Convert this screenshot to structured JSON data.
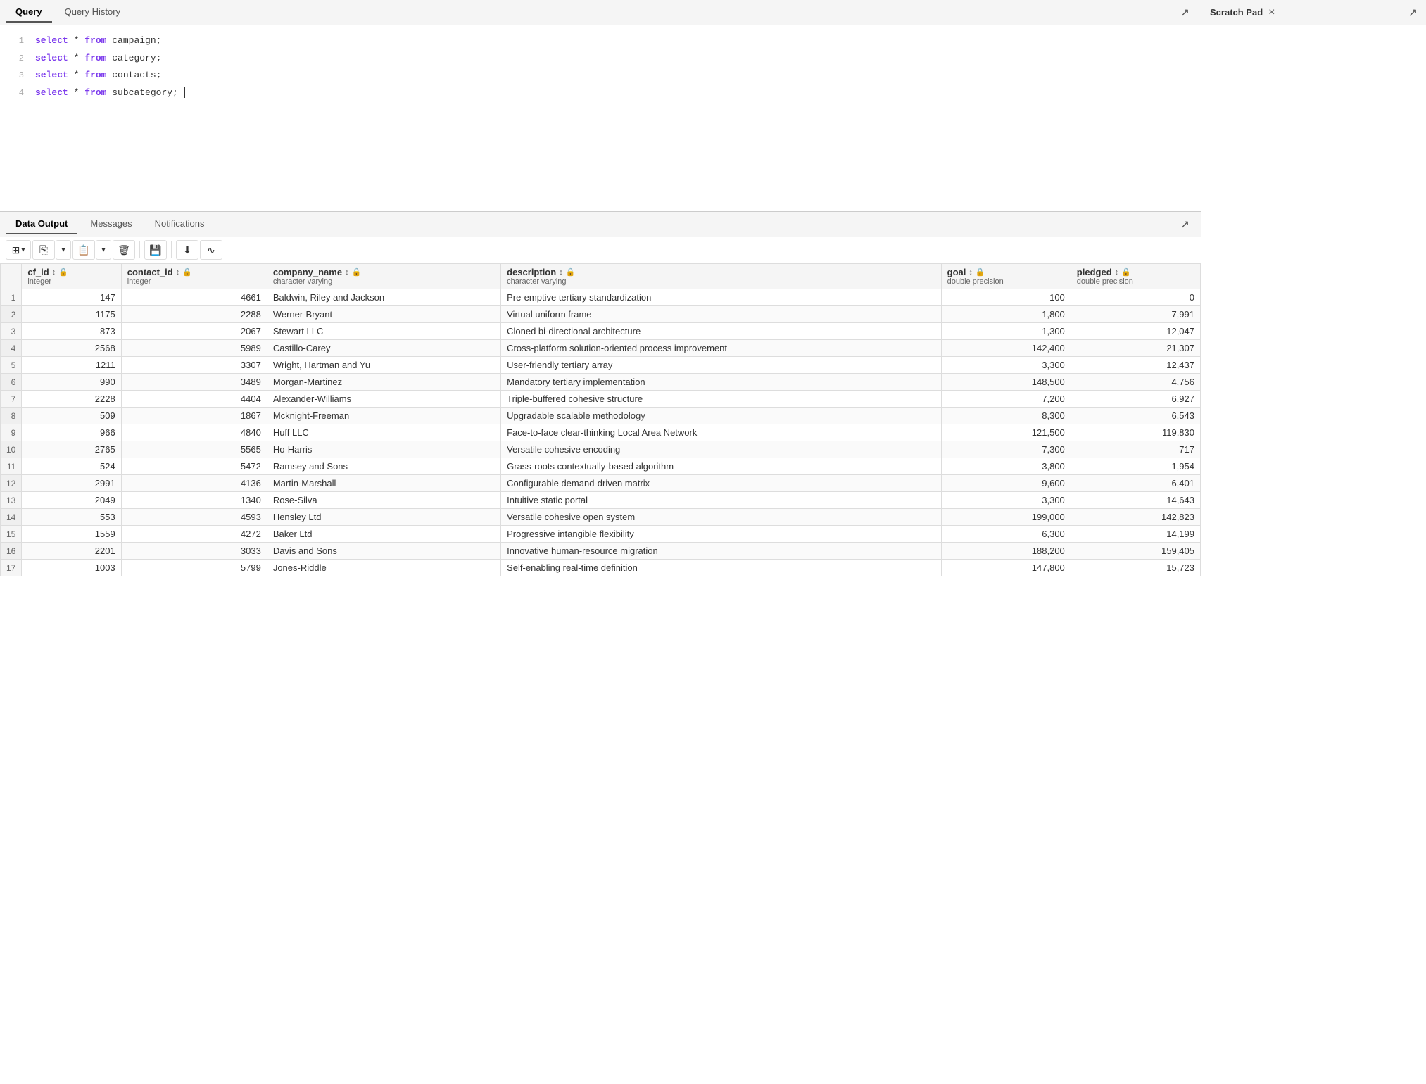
{
  "topTabs": {
    "query": "Query",
    "queryHistory": "Query History"
  },
  "queryEditor": {
    "expandIcon": "↗",
    "lines": [
      {
        "num": 1,
        "code": "select * from campaign;"
      },
      {
        "num": 2,
        "code": "select * from category;"
      },
      {
        "num": 3,
        "code": "select * from contacts;"
      },
      {
        "num": 4,
        "code": "select * from subcategory;"
      }
    ]
  },
  "scratchPad": {
    "title": "Scratch Pad",
    "closeIcon": "×",
    "expandIcon": "↗"
  },
  "outputTabs": {
    "dataOutput": "Data Output",
    "messages": "Messages",
    "notifications": "Notifications",
    "expandIcon": "↗"
  },
  "toolbar": {
    "addCol": "⊞",
    "copy": "⧉",
    "chevronDown": "∨",
    "paste": "⊡",
    "chevronDown2": "∨",
    "delete": "⊠",
    "save": "⛁",
    "download": "⬇",
    "graph": "∿"
  },
  "table": {
    "columns": [
      {
        "name": "cf_id",
        "type": "integer",
        "lock": true
      },
      {
        "name": "contact_id",
        "type": "integer",
        "lock": true
      },
      {
        "name": "company_name",
        "type": "character varying",
        "lock": true
      },
      {
        "name": "description",
        "type": "character varying",
        "lock": true
      },
      {
        "name": "goal",
        "type": "double precision",
        "lock": true
      },
      {
        "name": "pledged",
        "type": "double precision",
        "lock": true
      }
    ],
    "rows": [
      {
        "n": 1,
        "cf_id": 147,
        "contact_id": 4661,
        "company_name": "Baldwin, Riley and Jackson",
        "description": "Pre-emptive tertiary standardization",
        "goal": 100,
        "pledged": 0
      },
      {
        "n": 2,
        "cf_id": 1175,
        "contact_id": 2288,
        "company_name": "Werner-Bryant",
        "description": "Virtual uniform frame",
        "goal": 1800,
        "pledged": 7991
      },
      {
        "n": 3,
        "cf_id": 873,
        "contact_id": 2067,
        "company_name": "Stewart LLC",
        "description": "Cloned bi-directional architecture",
        "goal": 1300,
        "pledged": 12047
      },
      {
        "n": 4,
        "cf_id": 2568,
        "contact_id": 5989,
        "company_name": "Castillo-Carey",
        "description": "Cross-platform solution-oriented process improvement",
        "goal": 142400,
        "pledged": 21307
      },
      {
        "n": 5,
        "cf_id": 1211,
        "contact_id": 3307,
        "company_name": "Wright, Hartman and Yu",
        "description": "User-friendly tertiary array",
        "goal": 3300,
        "pledged": 12437
      },
      {
        "n": 6,
        "cf_id": 990,
        "contact_id": 3489,
        "company_name": "Morgan-Martinez",
        "description": "Mandatory tertiary implementation",
        "goal": 148500,
        "pledged": 4756
      },
      {
        "n": 7,
        "cf_id": 2228,
        "contact_id": 4404,
        "company_name": "Alexander-Williams",
        "description": "Triple-buffered cohesive structure",
        "goal": 7200,
        "pledged": 6927
      },
      {
        "n": 8,
        "cf_id": 509,
        "contact_id": 1867,
        "company_name": "Mcknight-Freeman",
        "description": "Upgradable scalable methodology",
        "goal": 8300,
        "pledged": 6543
      },
      {
        "n": 9,
        "cf_id": 966,
        "contact_id": 4840,
        "company_name": "Huff LLC",
        "description": "Face-to-face clear-thinking Local Area Network",
        "goal": 121500,
        "pledged": 119830
      },
      {
        "n": 10,
        "cf_id": 2765,
        "contact_id": 5565,
        "company_name": "Ho-Harris",
        "description": "Versatile cohesive encoding",
        "goal": 7300,
        "pledged": 717
      },
      {
        "n": 11,
        "cf_id": 524,
        "contact_id": 5472,
        "company_name": "Ramsey and Sons",
        "description": "Grass-roots contextually-based algorithm",
        "goal": 3800,
        "pledged": 1954
      },
      {
        "n": 12,
        "cf_id": 2991,
        "contact_id": 4136,
        "company_name": "Martin-Marshall",
        "description": "Configurable demand-driven matrix",
        "goal": 9600,
        "pledged": 6401
      },
      {
        "n": 13,
        "cf_id": 2049,
        "contact_id": 1340,
        "company_name": "Rose-Silva",
        "description": "Intuitive static portal",
        "goal": 3300,
        "pledged": 14643
      },
      {
        "n": 14,
        "cf_id": 553,
        "contact_id": 4593,
        "company_name": "Hensley Ltd",
        "description": "Versatile cohesive open system",
        "goal": 199000,
        "pledged": 142823
      },
      {
        "n": 15,
        "cf_id": 1559,
        "contact_id": 4272,
        "company_name": "Baker Ltd",
        "description": "Progressive intangible flexibility",
        "goal": 6300,
        "pledged": 14199
      },
      {
        "n": 16,
        "cf_id": 2201,
        "contact_id": 3033,
        "company_name": "Davis and Sons",
        "description": "Innovative human-resource migration",
        "goal": 188200,
        "pledged": 159405
      },
      {
        "n": 17,
        "cf_id": 1003,
        "contact_id": 5799,
        "company_name": "Jones-Riddle",
        "description": "Self-enabling real-time definition",
        "goal": 147800,
        "pledged": 15723
      }
    ]
  }
}
